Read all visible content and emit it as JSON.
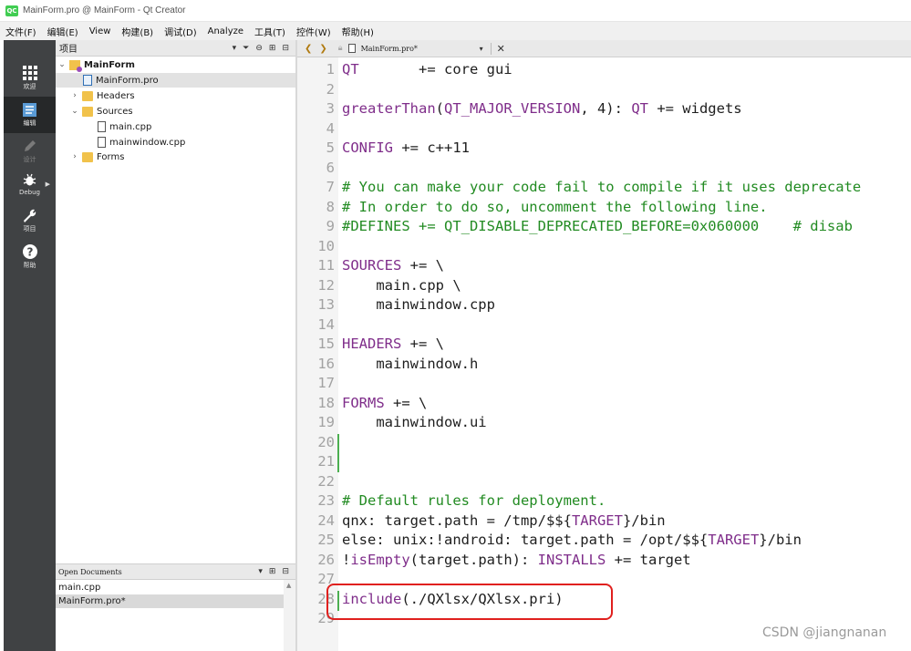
{
  "window": {
    "title": "MainForm.pro @ MainForm - Qt Creator",
    "logo": "QC"
  },
  "menu": [
    "文件(F)",
    "编辑(E)",
    "View",
    "构建(B)",
    "调试(D)",
    "Analyze",
    "工具(T)",
    "控件(W)",
    "帮助(H)"
  ],
  "modes": [
    {
      "label": "欢迎",
      "icon": "grid-icon"
    },
    {
      "label": "编辑",
      "icon": "edit-doc-icon"
    },
    {
      "label": "设计",
      "icon": "pencil-icon"
    },
    {
      "label": "Debug",
      "icon": "bug-icon"
    },
    {
      "label": "项目",
      "icon": "wrench-icon"
    },
    {
      "label": "帮助",
      "icon": "help-icon"
    }
  ],
  "projects": {
    "header": "项目",
    "tree": [
      {
        "label": "MainForm"
      },
      {
        "label": "MainForm.pro"
      },
      {
        "label": "Headers"
      },
      {
        "label": "Sources"
      },
      {
        "label": "main.cpp"
      },
      {
        "label": "mainwindow.cpp"
      },
      {
        "label": "Forms"
      }
    ]
  },
  "open_documents": {
    "header": "Open Documents",
    "items": [
      "main.cpp",
      "MainForm.pro*"
    ]
  },
  "editor": {
    "tab": "MainForm.pro*",
    "lines": [
      {
        "n": "1",
        "parts": [
          {
            "t": "QT",
            "c": "kw"
          },
          {
            "t": "       += core gui",
            "c": ""
          }
        ]
      },
      {
        "n": "2",
        "parts": []
      },
      {
        "n": "3",
        "parts": [
          {
            "t": "greaterThan",
            "c": "kw"
          },
          {
            "t": "(",
            "c": ""
          },
          {
            "t": "QT_MAJOR_VERSION",
            "c": "kw"
          },
          {
            "t": ", 4): ",
            "c": ""
          },
          {
            "t": "QT",
            "c": "kw"
          },
          {
            "t": " += widgets",
            "c": ""
          }
        ]
      },
      {
        "n": "4",
        "parts": []
      },
      {
        "n": "5",
        "parts": [
          {
            "t": "CONFIG",
            "c": "kw"
          },
          {
            "t": " += c++11",
            "c": ""
          }
        ]
      },
      {
        "n": "6",
        "parts": []
      },
      {
        "n": "7",
        "parts": [
          {
            "t": "# You can make your code fail to compile if it uses deprecate",
            "c": "cm"
          }
        ]
      },
      {
        "n": "8",
        "parts": [
          {
            "t": "# In order to do so, uncomment the following line.",
            "c": "cm"
          }
        ]
      },
      {
        "n": "9",
        "parts": [
          {
            "t": "#DEFINES += QT_DISABLE_DEPRECATED_BEFORE=0x060000    # disab",
            "c": "cm"
          }
        ]
      },
      {
        "n": "10",
        "parts": []
      },
      {
        "n": "11",
        "parts": [
          {
            "t": "SOURCES",
            "c": "kw"
          },
          {
            "t": " += \\",
            "c": ""
          }
        ]
      },
      {
        "n": "12",
        "parts": [
          {
            "t": "    main.cpp \\",
            "c": ""
          }
        ]
      },
      {
        "n": "13",
        "parts": [
          {
            "t": "    mainwindow.cpp",
            "c": ""
          }
        ]
      },
      {
        "n": "14",
        "parts": []
      },
      {
        "n": "15",
        "parts": [
          {
            "t": "HEADERS",
            "c": "kw"
          },
          {
            "t": " += \\",
            "c": ""
          }
        ]
      },
      {
        "n": "16",
        "parts": [
          {
            "t": "    mainwindow.h",
            "c": ""
          }
        ]
      },
      {
        "n": "17",
        "parts": []
      },
      {
        "n": "18",
        "parts": [
          {
            "t": "FORMS",
            "c": "kw"
          },
          {
            "t": " += \\",
            "c": ""
          }
        ]
      },
      {
        "n": "19",
        "parts": [
          {
            "t": "    mainwindow.ui",
            "c": ""
          }
        ]
      },
      {
        "n": "20",
        "parts": []
      },
      {
        "n": "21",
        "parts": []
      },
      {
        "n": "22",
        "parts": []
      },
      {
        "n": "23",
        "parts": [
          {
            "t": "# Default rules for deployment.",
            "c": "cm"
          }
        ]
      },
      {
        "n": "24",
        "parts": [
          {
            "t": "qnx: target.path = /tmp/$${",
            "c": ""
          },
          {
            "t": "TARGET",
            "c": "kw"
          },
          {
            "t": "}/bin",
            "c": ""
          }
        ]
      },
      {
        "n": "25",
        "parts": [
          {
            "t": "else: unix:!android: target.path = /opt/$${",
            "c": ""
          },
          {
            "t": "TARGET",
            "c": "kw"
          },
          {
            "t": "}/bin",
            "c": ""
          }
        ]
      },
      {
        "n": "26",
        "parts": [
          {
            "t": "!",
            "c": ""
          },
          {
            "t": "isEmpty",
            "c": "kw"
          },
          {
            "t": "(target.path): ",
            "c": ""
          },
          {
            "t": "INSTALLS",
            "c": "kw"
          },
          {
            "t": " += target",
            "c": ""
          }
        ]
      },
      {
        "n": "27",
        "parts": []
      },
      {
        "n": "28",
        "parts": [
          {
            "t": "include",
            "c": "kw"
          },
          {
            "t": "(./QXlsx/QXlsx.pri)",
            "c": ""
          }
        ]
      },
      {
        "n": "29",
        "parts": []
      }
    ]
  },
  "watermark": "CSDN @jiangnanan",
  "colors": {
    "keyword": "#7f2d8a",
    "comment": "#228b22",
    "highlight": "#e0201e",
    "modebar": "#404244"
  }
}
